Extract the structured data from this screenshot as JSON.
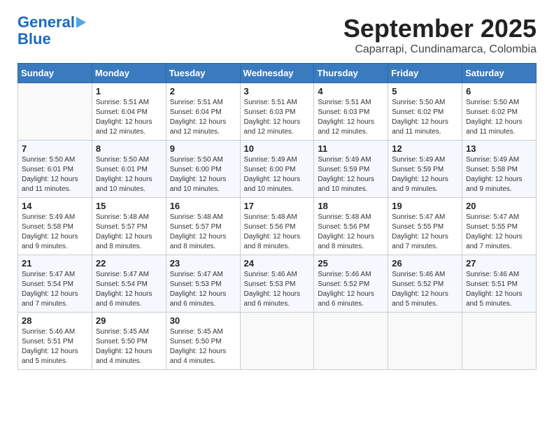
{
  "logo": {
    "line1": "General",
    "line2": "Blue"
  },
  "title": "September 2025",
  "subtitle": "Caparrapi, Cundinamarca, Colombia",
  "days": [
    "Sunday",
    "Monday",
    "Tuesday",
    "Wednesday",
    "Thursday",
    "Friday",
    "Saturday"
  ],
  "weeks": [
    [
      {
        "day": "",
        "info": ""
      },
      {
        "day": "1",
        "info": "Sunrise: 5:51 AM\nSunset: 6:04 PM\nDaylight: 12 hours\nand 12 minutes."
      },
      {
        "day": "2",
        "info": "Sunrise: 5:51 AM\nSunset: 6:04 PM\nDaylight: 12 hours\nand 12 minutes."
      },
      {
        "day": "3",
        "info": "Sunrise: 5:51 AM\nSunset: 6:03 PM\nDaylight: 12 hours\nand 12 minutes."
      },
      {
        "day": "4",
        "info": "Sunrise: 5:51 AM\nSunset: 6:03 PM\nDaylight: 12 hours\nand 12 minutes."
      },
      {
        "day": "5",
        "info": "Sunrise: 5:50 AM\nSunset: 6:02 PM\nDaylight: 12 hours\nand 11 minutes."
      },
      {
        "day": "6",
        "info": "Sunrise: 5:50 AM\nSunset: 6:02 PM\nDaylight: 12 hours\nand 11 minutes."
      }
    ],
    [
      {
        "day": "7",
        "info": "Sunrise: 5:50 AM\nSunset: 6:01 PM\nDaylight: 12 hours\nand 11 minutes."
      },
      {
        "day": "8",
        "info": "Sunrise: 5:50 AM\nSunset: 6:01 PM\nDaylight: 12 hours\nand 10 minutes."
      },
      {
        "day": "9",
        "info": "Sunrise: 5:50 AM\nSunset: 6:00 PM\nDaylight: 12 hours\nand 10 minutes."
      },
      {
        "day": "10",
        "info": "Sunrise: 5:49 AM\nSunset: 6:00 PM\nDaylight: 12 hours\nand 10 minutes."
      },
      {
        "day": "11",
        "info": "Sunrise: 5:49 AM\nSunset: 5:59 PM\nDaylight: 12 hours\nand 10 minutes."
      },
      {
        "day": "12",
        "info": "Sunrise: 5:49 AM\nSunset: 5:59 PM\nDaylight: 12 hours\nand 9 minutes."
      },
      {
        "day": "13",
        "info": "Sunrise: 5:49 AM\nSunset: 5:58 PM\nDaylight: 12 hours\nand 9 minutes."
      }
    ],
    [
      {
        "day": "14",
        "info": "Sunrise: 5:49 AM\nSunset: 5:58 PM\nDaylight: 12 hours\nand 9 minutes."
      },
      {
        "day": "15",
        "info": "Sunrise: 5:48 AM\nSunset: 5:57 PM\nDaylight: 12 hours\nand 8 minutes."
      },
      {
        "day": "16",
        "info": "Sunrise: 5:48 AM\nSunset: 5:57 PM\nDaylight: 12 hours\nand 8 minutes."
      },
      {
        "day": "17",
        "info": "Sunrise: 5:48 AM\nSunset: 5:56 PM\nDaylight: 12 hours\nand 8 minutes."
      },
      {
        "day": "18",
        "info": "Sunrise: 5:48 AM\nSunset: 5:56 PM\nDaylight: 12 hours\nand 8 minutes."
      },
      {
        "day": "19",
        "info": "Sunrise: 5:47 AM\nSunset: 5:55 PM\nDaylight: 12 hours\nand 7 minutes."
      },
      {
        "day": "20",
        "info": "Sunrise: 5:47 AM\nSunset: 5:55 PM\nDaylight: 12 hours\nand 7 minutes."
      }
    ],
    [
      {
        "day": "21",
        "info": "Sunrise: 5:47 AM\nSunset: 5:54 PM\nDaylight: 12 hours\nand 7 minutes."
      },
      {
        "day": "22",
        "info": "Sunrise: 5:47 AM\nSunset: 5:54 PM\nDaylight: 12 hours\nand 6 minutes."
      },
      {
        "day": "23",
        "info": "Sunrise: 5:47 AM\nSunset: 5:53 PM\nDaylight: 12 hours\nand 6 minutes."
      },
      {
        "day": "24",
        "info": "Sunrise: 5:46 AM\nSunset: 5:53 PM\nDaylight: 12 hours\nand 6 minutes."
      },
      {
        "day": "25",
        "info": "Sunrise: 5:46 AM\nSunset: 5:52 PM\nDaylight: 12 hours\nand 6 minutes."
      },
      {
        "day": "26",
        "info": "Sunrise: 5:46 AM\nSunset: 5:52 PM\nDaylight: 12 hours\nand 5 minutes."
      },
      {
        "day": "27",
        "info": "Sunrise: 5:46 AM\nSunset: 5:51 PM\nDaylight: 12 hours\nand 5 minutes."
      }
    ],
    [
      {
        "day": "28",
        "info": "Sunrise: 5:46 AM\nSunset: 5:51 PM\nDaylight: 12 hours\nand 5 minutes."
      },
      {
        "day": "29",
        "info": "Sunrise: 5:45 AM\nSunset: 5:50 PM\nDaylight: 12 hours\nand 4 minutes."
      },
      {
        "day": "30",
        "info": "Sunrise: 5:45 AM\nSunset: 5:50 PM\nDaylight: 12 hours\nand 4 minutes."
      },
      {
        "day": "",
        "info": ""
      },
      {
        "day": "",
        "info": ""
      },
      {
        "day": "",
        "info": ""
      },
      {
        "day": "",
        "info": ""
      }
    ]
  ]
}
